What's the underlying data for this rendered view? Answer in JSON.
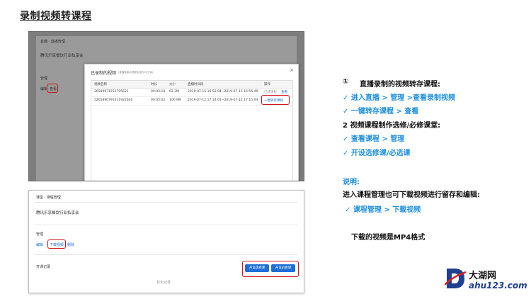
{
  "title": "录制视频转课程",
  "shot1": {
    "breadcrumb": "直播 · 直播管理",
    "room_name": "腾讯乐享餐饮行业私享会",
    "manage_label": "管理",
    "edit_link": "编辑",
    "view_link": "查看",
    "modal": {
      "title": "已录制的视频",
      "hint": "(直播结束后视频生成约30分钟)",
      "close": "×",
      "columns": [
        "视频名称",
        "时长",
        "大小",
        "直播时间段",
        "操作"
      ],
      "rows": [
        {
          "name": "265890715537956​21",
          "duration": "00:03:10",
          "size": "63.3M",
          "time": "2019-07-15 16:52:04~2019-07-15 16:56:49",
          "action1": "已转课程",
          "action2": "查看"
        },
        {
          "name": "5265890791431922040",
          "duration": "00:05:02",
          "size": "100.9M",
          "time": "2019-07-12 17:14:01~2019-07-12 17:15:04",
          "action1": "一键转存课程",
          "action2": ""
        }
      ]
    }
  },
  "shot2": {
    "breadcrumb": "课堂 · 课程管理",
    "course_name": "腾讯乐享餐饮行业私享会",
    "manage_label": "管理",
    "links": [
      "编辑",
      "下载视频",
      "删除"
    ],
    "record_label": "开课记录",
    "btn_elective": "开设选修课",
    "btn_required": "开设必修课",
    "empty_text": "暂无记录"
  },
  "instructions": {
    "s1_num": "①",
    "s1_title": "直播录制的视频转存课程:",
    "s1_step1": "✓ 进入直播 > 管理 >查看录制视频",
    "s1_step2": "✓ 一键转存课程 > 查看",
    "s2_title": "2 视频课程制作选修/必修课堂:",
    "s2_step1": "✓ 查看课程 > 管理",
    "s2_step2": "✓ 开设选修课/必选课",
    "note_label": "说明:",
    "note_text": "进入课程管理也可下载视频进行留存和编辑:",
    "note_step": "✓ 课程管理 > 下载视频",
    "format_text": "下载的视频是MP4格式"
  },
  "logo": {
    "glyph": "D",
    "name": "大湖网",
    "domain": "ahu123.com"
  },
  "colors": {
    "accent_blue": "#1e8fe0",
    "highlight_red": "#d1131b",
    "button_blue": "#1e6fd9"
  }
}
